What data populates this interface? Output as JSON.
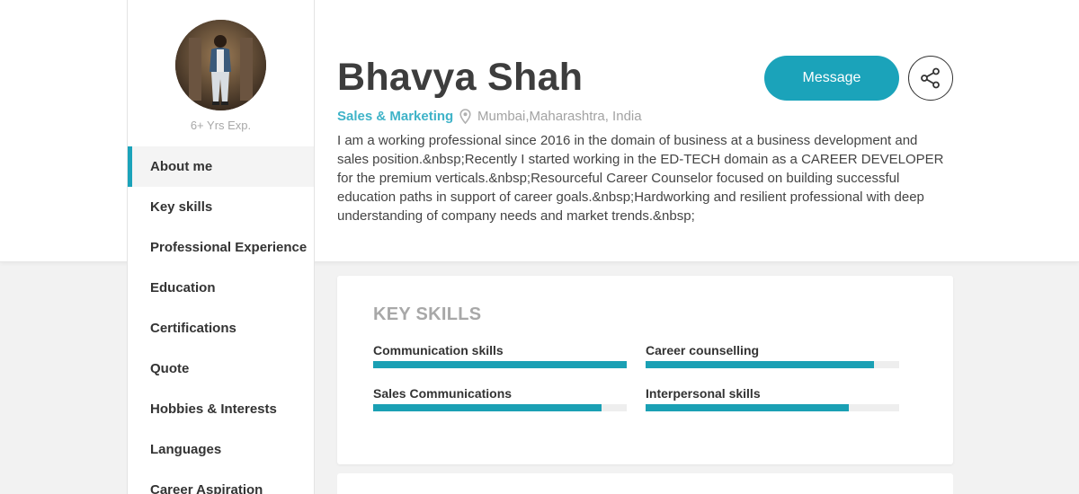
{
  "profile": {
    "experience": "6+ Yrs Exp.",
    "name": "Bhavya Shah",
    "role": "Sales & Marketing",
    "location": "Mumbai,Maharashtra, India",
    "bio": "I am a working professional since 2016 in the domain of business at a business development and sales position.&nbsp;Recently I started working in the ED-TECH domain as a CAREER DEVELOPER for the premium verticals.&nbsp;Resourceful Career Counselor focused on building successful education paths in support of career goals.&nbsp;Hardworking and resilient professional with deep understanding of company needs and market trends.&nbsp;"
  },
  "actions": {
    "message_label": "Message",
    "share_icon": "share-icon"
  },
  "sidebar": {
    "items": [
      {
        "label": "About me",
        "active": true
      },
      {
        "label": "Key skills"
      },
      {
        "label": "Professional Experience"
      },
      {
        "label": "Education"
      },
      {
        "label": "Certifications"
      },
      {
        "label": "Quote"
      },
      {
        "label": "Hobbies & Interests"
      },
      {
        "label": "Languages"
      },
      {
        "label": "Career Aspiration"
      }
    ]
  },
  "skills_card": {
    "title": "KEY SKILLS",
    "skills": [
      {
        "label": "Communication skills",
        "level": 1.0
      },
      {
        "label": "Career counselling",
        "level": 0.9
      },
      {
        "label": "Sales Communications",
        "level": 0.9
      },
      {
        "label": "Interpersonal skills",
        "level": 0.8
      }
    ]
  },
  "colors": {
    "accent": "#1ba3ba",
    "role_text": "#3fb3c8",
    "skill_bar": "#1aa0b4"
  }
}
